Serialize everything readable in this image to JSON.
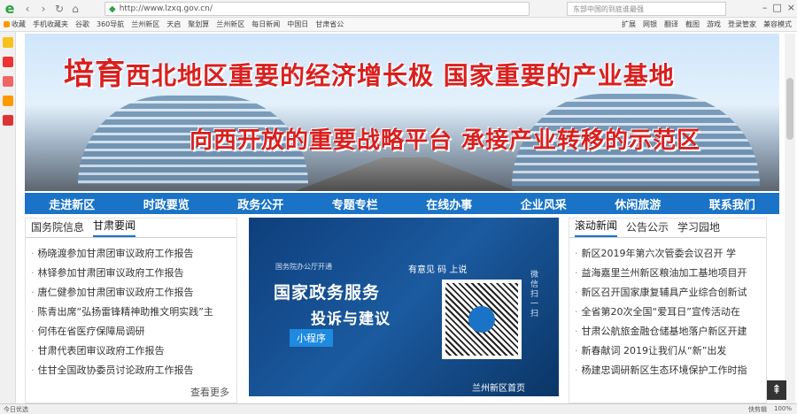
{
  "browser": {
    "url": "http://www.lzxq.gov.cn/",
    "search_placeholder": "东部中国的到底谁最强",
    "bookmarks": [
      "收藏",
      "手机收藏夹",
      "谷歌",
      "360导航",
      "兰州新区",
      "天启",
      "聚划算",
      "兰州新区",
      "每日新闻",
      "中国日",
      "甘肃省公"
    ],
    "right_tools": [
      "扩展",
      "网银",
      "翻译",
      "截图",
      "游戏",
      "登录管家",
      "兼容模式"
    ]
  },
  "banner": {
    "line1_lead": "培育",
    "line1_rest": "西北地区重要的经济增长极   国家重要的产业基地",
    "line2": "向西开放的重要战略平台   承接产业转移的示范区"
  },
  "nav": [
    "走进新区",
    "时政要览",
    "政务公开",
    "专题专栏",
    "在线办事",
    "企业风采",
    "休闲旅游",
    "联系我们"
  ],
  "left": {
    "tabs": [
      "国务院信息",
      "甘肃要闻"
    ],
    "items": [
      "杨晓渡参加甘肃团审议政府工作报告",
      "林铎参加甘肃团审议政府工作报告",
      "唐仁健参加甘肃团审议政府工作报告",
      "陈青出席“弘扬雷锋精神助推文明实践”主",
      "何伟在省医疗保障局调研",
      "甘肃代表团审议政府工作报告",
      "住甘全国政协委员讨论政府工作报告"
    ],
    "more": "查看更多"
  },
  "promo": {
    "small": "国务院办公厅开通",
    "title1": "国家政务服务",
    "title2": "投诉与建议",
    "tag": "小程序",
    "hint": "有意见 码 上说",
    "side": "微信扫一扫",
    "footer": "兰州新区首页"
  },
  "right": {
    "tabs": [
      "滚动新闻",
      "公告公示",
      "学习园地"
    ],
    "items": [
      "新区2019年第六次管委会议召开 学",
      "益海嘉里兰州新区粮油加工基地项目开",
      "新区召开国家康复辅具产业综合创新试",
      "全省第20次全国“爱耳日”宣传活动在",
      "甘肃公航旅金融仓储基地落户新区开建",
      "新春献词 2019让我们从“新”出发",
      "杨建忠调研新区生态环境保护工作时指"
    ]
  },
  "status": {
    "left": "今日优选",
    "right": [
      "快剪辑",
      "100%"
    ]
  }
}
